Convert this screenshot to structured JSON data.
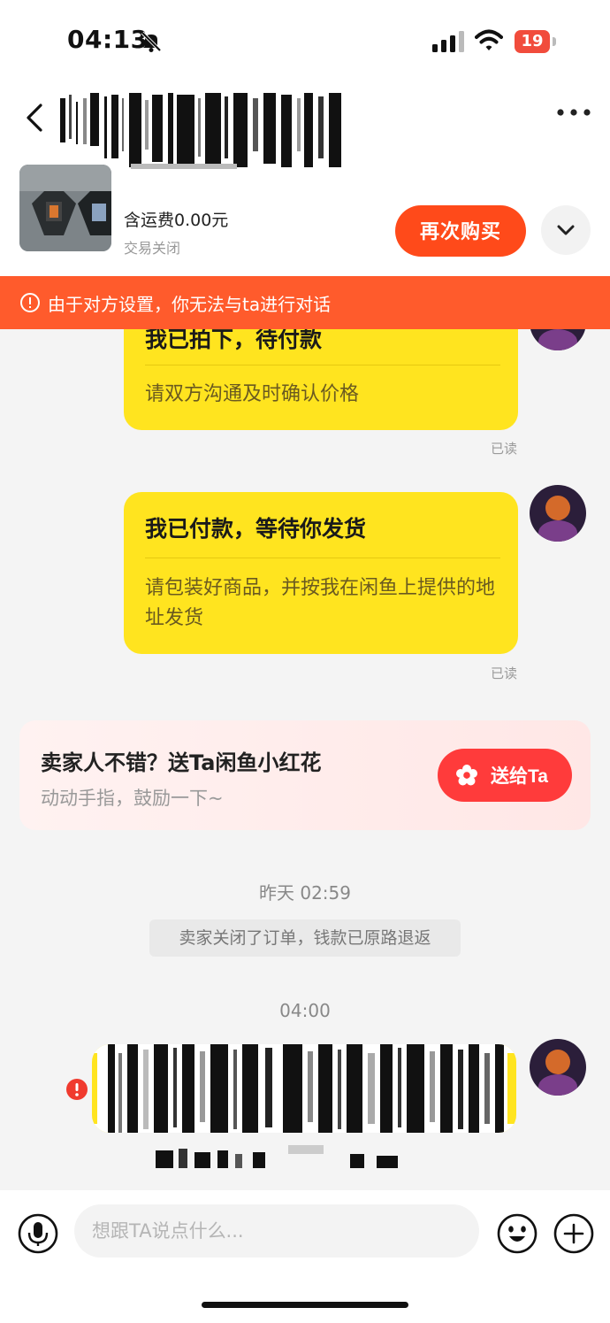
{
  "status_bar": {
    "time": "04:13",
    "battery": "19"
  },
  "order": {
    "price": "含运费0.00元",
    "status": "交易关闭",
    "buy_again_label": "再次购买"
  },
  "warning": {
    "text": "由于对方设置，你无法与ta进行对话"
  },
  "messages": [
    {
      "title": "我已拍下，待付款",
      "body": "请双方沟通及时确认价格",
      "read": "已读"
    },
    {
      "title": "我已付款，等待你发货",
      "body": "请包装好商品，并按我在闲鱼上提供的地址发货",
      "read": "已读"
    }
  ],
  "flower_card": {
    "title": "卖家人不错？送Ta闲鱼小红花",
    "subtitle": "动动手指，鼓励一下~",
    "button_label": "送给Ta"
  },
  "timeline": {
    "yesterday": "昨天 02:59",
    "system_message": "卖家关闭了订单，钱款已原路退返",
    "now": "04:00"
  },
  "input": {
    "placeholder": "想跟TA说点什么..."
  },
  "colors": {
    "accent": "#ff4a1a",
    "bubble": "#ffe41f",
    "warning": "#ff5b2c",
    "flower_button": "#ff3b3b"
  },
  "icons": [
    "back-icon",
    "more-icon",
    "bell-off-icon",
    "signal-icon",
    "wifi-icon",
    "chevron-down-icon",
    "warning-icon",
    "flower-icon",
    "error-icon",
    "microphone-icon",
    "emoji-icon",
    "plus-icon"
  ]
}
